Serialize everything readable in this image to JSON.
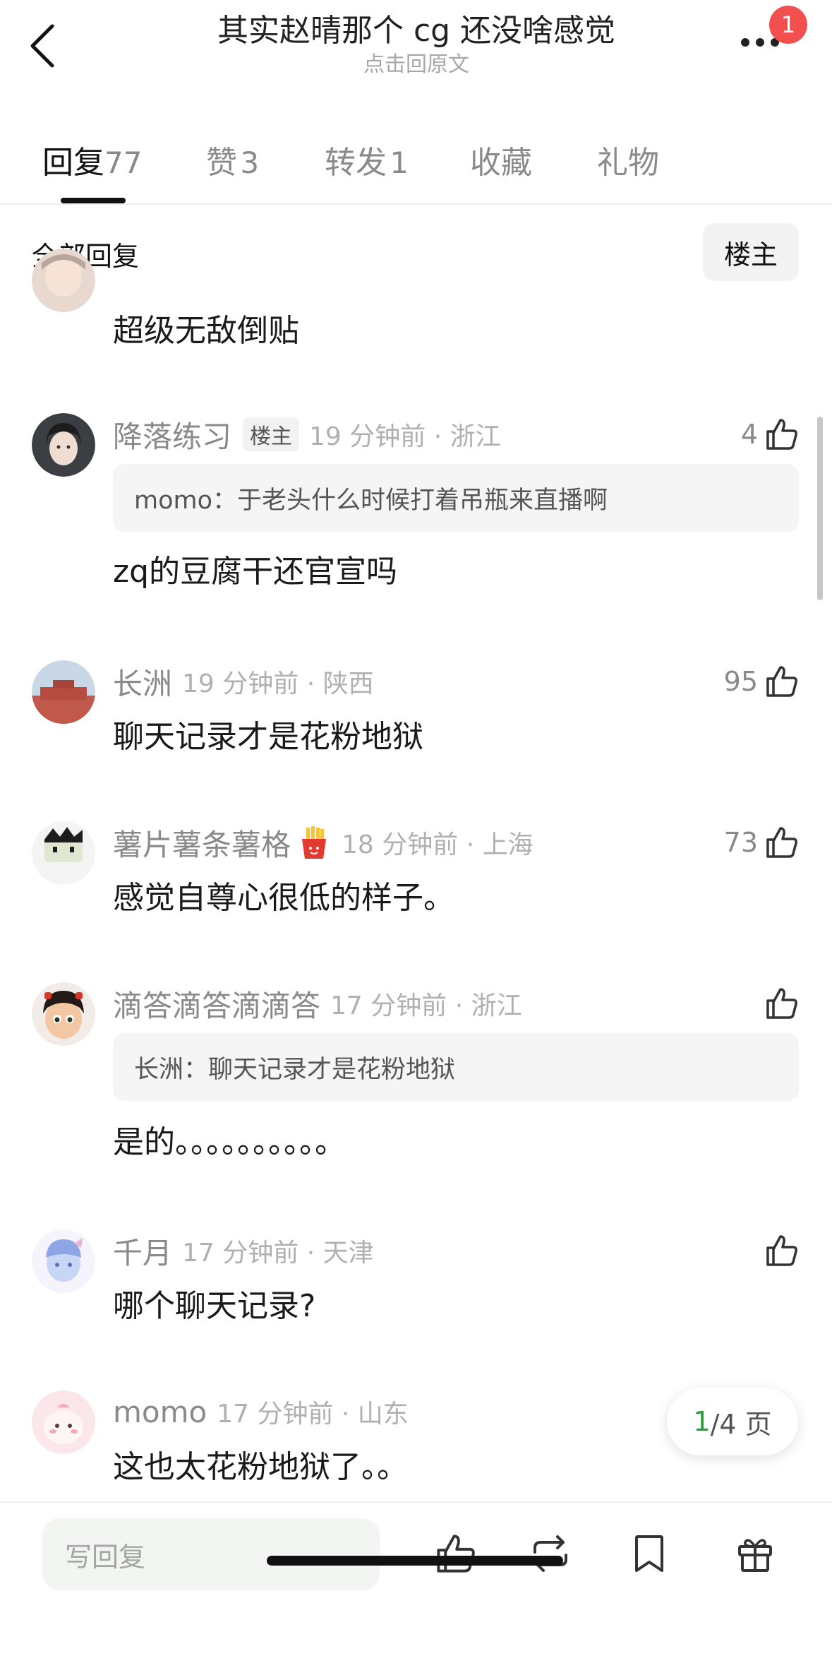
{
  "header": {
    "title": "其实赵晴那个 cg 还没啥感觉",
    "subtitle": "点击回原文",
    "badge_count": "1"
  },
  "tabs": [
    {
      "label": "回复",
      "count": "77",
      "active": true
    },
    {
      "label": "赞",
      "count": "3"
    },
    {
      "label": "转发",
      "count": "1"
    },
    {
      "label": "收藏",
      "count": ""
    },
    {
      "label": "礼物",
      "count": ""
    }
  ],
  "section": {
    "title": "全部回复",
    "filter_label": "楼主"
  },
  "comments": [
    {
      "text": "超级无敌倒贴"
    },
    {
      "name": "降落练习",
      "tag": "楼主",
      "time": "19 分钟前 · 浙江",
      "likes": "4",
      "quote": "momo：于老头什么时候打着吊瓶来直播啊",
      "text": "zq的豆腐干还官宣吗"
    },
    {
      "name": "长洲",
      "time": "19 分钟前 · 陕西",
      "likes": "95",
      "text": "聊天记录才是花粉地狱"
    },
    {
      "name": "薯片薯条薯格",
      "emoji": "fries-emoji",
      "time": "18 分钟前 · 上海",
      "likes": "73",
      "text": "感觉自尊心很低的样子。"
    },
    {
      "name": "滴答滴答滴滴答",
      "time": "17 分钟前 · 浙江",
      "likes": "",
      "quote": "长洲：聊天记录才是花粉地狱",
      "text": "是的。。。。。。。。。。"
    },
    {
      "name": "千月",
      "time": "17 分钟前 · 天津",
      "likes": "",
      "text": "哪个聊天记录?"
    },
    {
      "name": "momo",
      "time": "17 分钟前 · 山东",
      "likes": "",
      "text": "这也太花粉地狱了。。"
    }
  ],
  "pager": {
    "current": "1",
    "total": "/4 页"
  },
  "bottom_bar": {
    "reply_placeholder": "写回复",
    "icons": [
      "like-icon",
      "repost-icon",
      "bookmark-icon",
      "gift-icon"
    ]
  },
  "colors": {
    "accent_green": "#2a9d3c",
    "badge_red": "#f24f4f"
  }
}
